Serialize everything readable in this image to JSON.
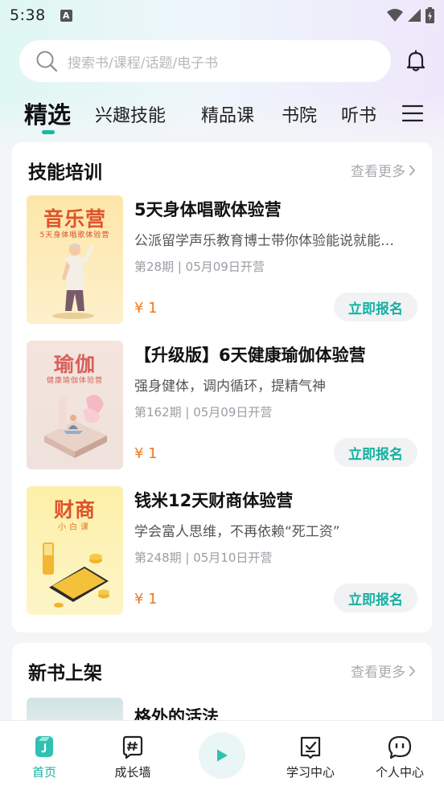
{
  "status": {
    "time": "5:38",
    "notif_glyph": "A"
  },
  "search": {
    "placeholder": "搜索书/课程/话题/电子书"
  },
  "tabs": [
    {
      "label": "精选",
      "active": true
    },
    {
      "label": "兴趣技能"
    },
    {
      "label": "精品课"
    },
    {
      "label": "书院"
    },
    {
      "label": "听书"
    }
  ],
  "skills": {
    "title": "技能培训",
    "more": "查看更多",
    "courses": [
      {
        "cover_title": "音乐营",
        "cover_sub": "5天身体唱歌体验营",
        "title": "5天身体唱歌体验营",
        "desc": "公派留学声乐教育博士带你体验能说就能…",
        "period": "第28期 | 05月09日开营",
        "price": "¥ 1",
        "button": "立即报名"
      },
      {
        "cover_title": "瑜伽",
        "cover_sub": "健康瑜伽体验营",
        "title": "【升级版】6天健康瑜伽体验营",
        "desc": "强身健体，调内循环，提精气神",
        "period": "第162期 | 05月09日开营",
        "price": "¥ 1",
        "button": "立即报名"
      },
      {
        "cover_title": "财商",
        "cover_sub": "小白课",
        "title": "钱米12天财商体验营",
        "desc": "学会富人思维，不再依赖“死工资”",
        "period": "第248期 | 05月10日开营",
        "price": "¥ 1",
        "button": "立即报名"
      }
    ]
  },
  "new_books": {
    "title": "新书上架",
    "more": "查看更多",
    "first_title": "格外的活法"
  },
  "nav": [
    {
      "label": "首页",
      "active": true,
      "icon": "home-icon"
    },
    {
      "label": "成长墙",
      "icon": "hashtag-icon"
    },
    {
      "label": "",
      "icon": "play-icon"
    },
    {
      "label": "学习中心",
      "icon": "study-icon"
    },
    {
      "label": "个人中心",
      "icon": "profile-icon"
    }
  ],
  "colors": {
    "accent": "#17b0a2",
    "price": "#f07a1f"
  }
}
